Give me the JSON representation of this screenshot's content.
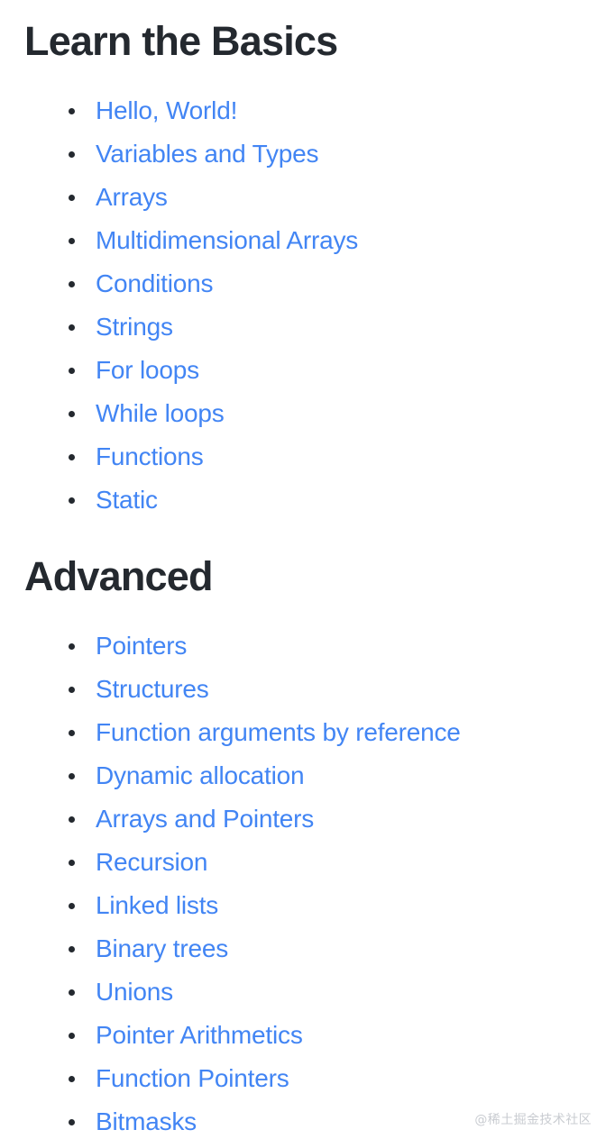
{
  "colors": {
    "background": "#ffffff",
    "heading": "#24292f",
    "link": "#4285f4",
    "bullet": "#24292f",
    "watermark": "#c9ccd1"
  },
  "sections": [
    {
      "heading": "Learn the Basics",
      "items": [
        {
          "label": "Hello, World!"
        },
        {
          "label": "Variables and Types"
        },
        {
          "label": "Arrays"
        },
        {
          "label": "Multidimensional Arrays"
        },
        {
          "label": "Conditions"
        },
        {
          "label": "Strings"
        },
        {
          "label": "For loops"
        },
        {
          "label": "While loops"
        },
        {
          "label": "Functions"
        },
        {
          "label": "Static"
        }
      ]
    },
    {
      "heading": "Advanced",
      "items": [
        {
          "label": "Pointers"
        },
        {
          "label": "Structures"
        },
        {
          "label": "Function arguments by reference"
        },
        {
          "label": "Dynamic allocation"
        },
        {
          "label": "Arrays and Pointers"
        },
        {
          "label": "Recursion"
        },
        {
          "label": "Linked lists"
        },
        {
          "label": "Binary trees"
        },
        {
          "label": "Unions"
        },
        {
          "label": "Pointer Arithmetics"
        },
        {
          "label": "Function Pointers"
        },
        {
          "label": "Bitmasks"
        }
      ]
    }
  ],
  "watermark": "@稀土掘金技术社区"
}
